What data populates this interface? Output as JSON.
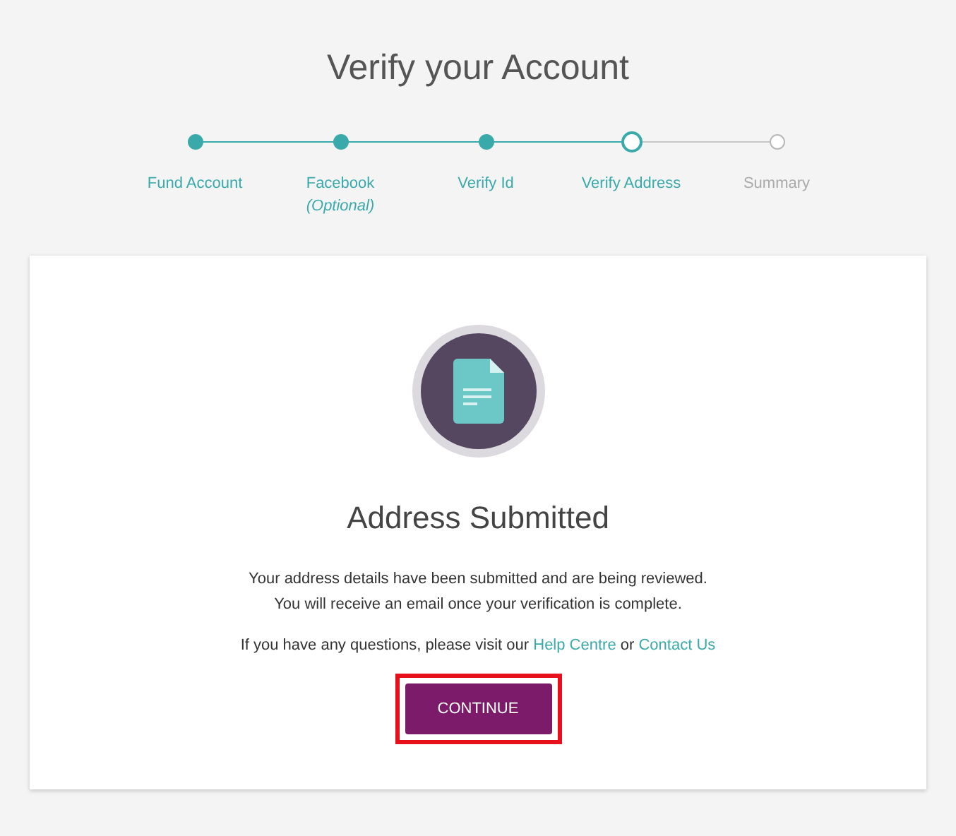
{
  "title": "Verify your Account",
  "steps": [
    {
      "label": "Fund Account",
      "kind": "done"
    },
    {
      "label": "Facebook",
      "note": "(Optional)",
      "kind": "done"
    },
    {
      "label": "Verify Id",
      "kind": "done"
    },
    {
      "label": "Verify Address",
      "kind": "current"
    },
    {
      "label": "Summary",
      "kind": "upcoming"
    }
  ],
  "card": {
    "heading": "Address Submitted",
    "message": [
      "Your address details have been submitted and are being reviewed.",
      "You will receive an email once your verification is complete."
    ],
    "help": {
      "text": "If you have any questions, please visit our",
      "links": [
        "Help Centre",
        "Contact Us"
      ],
      "joiner": "or"
    },
    "button": {
      "label": "CONTINUE",
      "highlighted": true
    }
  }
}
